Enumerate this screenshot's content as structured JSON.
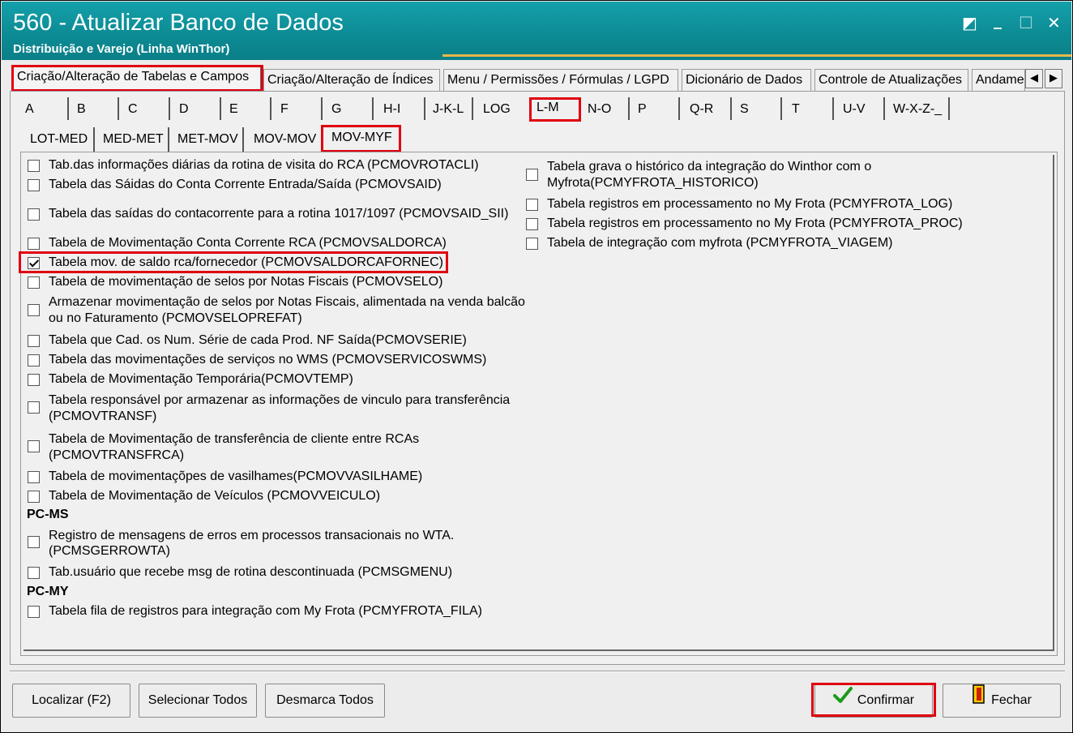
{
  "window": {
    "title": "560 - Atualizar Banco de Dados",
    "subtitle": "Distribuição e Varejo (Linha WinThor)",
    "controls": {
      "restore": "◩",
      "minimize": "_",
      "maximize": "☐",
      "close": "✕"
    }
  },
  "top_tabs": [
    {
      "label": "Criação/Alteração de Tabelas e Campos",
      "active": true
    },
    {
      "label": "Criação/Alteração de Índices"
    },
    {
      "label": "Menu / Permissões / Fórmulas / LGPD"
    },
    {
      "label": "Dicionário de Dados"
    },
    {
      "label": "Controle de Atualizações"
    },
    {
      "label": "Andame"
    }
  ],
  "tab_scroll": {
    "left": "◀",
    "right": "▶"
  },
  "letter_tabs": [
    "A",
    "B",
    "C",
    "D",
    "E",
    "F",
    "G",
    "H-I",
    "J-K-L",
    "LOG",
    "L-M",
    "N-O",
    "P",
    "Q-R",
    "S",
    "T",
    "U-V",
    "W-X-Z-_"
  ],
  "letter_tab_active": "L-M",
  "sub_tabs": [
    "LOT-MED",
    "MED-MET",
    "MET-MOV",
    "MOV-MOV",
    "MOV-MYF"
  ],
  "sub_tab_active": "MOV-MYF",
  "left_items": [
    {
      "text": "Tab.das informações diárias da rotina de visita do RCA (PCMOVROTACLI)",
      "checked": false
    },
    {
      "text": "Tabela das Sáidas do Conta Corrente Entrada/Saída (PCMOVSAID)",
      "checked": false
    },
    {
      "text": "Tabela das saídas do contacorrente para a rotina 1017/1097 (PCMOVSAID_SII)",
      "checked": false
    },
    {
      "text": "Tabela de Movimentação Conta Corrente RCA (PCMOVSALDORCA)",
      "checked": false
    },
    {
      "text": "Tabela mov. de saldo rca/fornecedor (PCMOVSALDORCAFORNEC)",
      "checked": true
    },
    {
      "text": "Tabela de movimentação de selos por Notas Fiscais (PCMOVSELO)",
      "checked": false
    },
    {
      "text": "Armazenar movimentação de selos por Notas Fiscais, alimentada na venda balcão",
      "text2": "ou no Faturamento (PCMOVSELOPREFAT)",
      "checked": false
    },
    {
      "text": "Tabela que Cad. os Num. Série de cada Prod. NF Saída(PCMOVSERIE)",
      "checked": false
    },
    {
      "text": "Tabela das movimentações de serviços no WMS (PCMOVSERVICOSWMS)",
      "checked": false
    },
    {
      "text": "Tabela de Movimentação Temporária(PCMOVTEMP)",
      "checked": false
    },
    {
      "text": "Tabela responsável por armazenar as informações de vinculo para transferência",
      "text2": "(PCMOVTRANSF)",
      "checked": false
    },
    {
      "text": "Tabela de Movimentação de transferência de cliente entre RCAs",
      "text2": "(PCMOVTRANSFRCA)",
      "checked": false
    },
    {
      "text": "Tabela de movimentaçõpes de vasilhames(PCMOVVASILHAME)",
      "checked": false
    },
    {
      "text": "Tabela de Movimentação de Veículos (PCMOVVEICULO)",
      "checked": false
    }
  ],
  "group_ms": {
    "header": "PC-MS",
    "items": [
      {
        "text": "Registro de mensagens de erros em processos transacionais no WTA.",
        "text2": "(PCMSGERROWTA)",
        "checked": false
      },
      {
        "text": "Tab.usuário que recebe msg de rotina descontinuada (PCMSGMENU)",
        "checked": false
      }
    ]
  },
  "group_my": {
    "header": "PC-MY",
    "items": [
      {
        "text": "Tabela fila de registros para integração com My Frota (PCMYFROTA_FILA)",
        "checked": false
      }
    ]
  },
  "right_items": [
    {
      "text": "Tabela grava o histórico da integração do Winthor com o",
      "text2": "Myfrota(PCMYFROTA_HISTORICO)",
      "checked": false
    },
    {
      "text": "Tabela registros em processamento no My Frota (PCMYFROTA_LOG)",
      "checked": false
    },
    {
      "text": "Tabela registros em processamento no My Frota (PCMYFROTA_PROC)",
      "checked": false
    },
    {
      "text": "Tabela de integração com myfrota (PCMYFROTA_VIAGEM)",
      "checked": false
    }
  ],
  "buttons": {
    "localizar": "Localizar (F2)",
    "selecionar": "Selecionar Todos",
    "desmarca": "Desmarca Todos",
    "confirmar": "Confirmar",
    "fechar": "Fechar"
  },
  "icons": {
    "confirm": "checkmark-icon",
    "close": "exit-door-icon"
  },
  "colors": {
    "title_bar": "#0c8a93",
    "highlight": "#e00010",
    "accent_line": "#e8b84a"
  }
}
